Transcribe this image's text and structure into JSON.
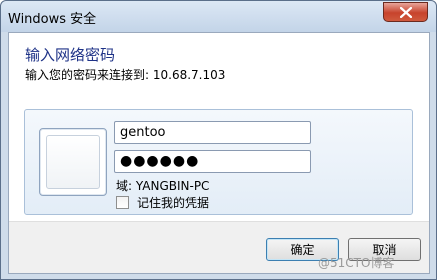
{
  "window": {
    "title": "Windows 安全",
    "close_icon": "close-icon"
  },
  "header": {
    "heading": "输入网络密码",
    "subheading": "输入您的密码来连接到: 10.68.7.103"
  },
  "credentials": {
    "username_value": "gentoo",
    "password_masked": "●●●●●●",
    "domain_text": "域: YANGBIN-PC",
    "remember_label": "记住我的凭据",
    "remember_checked": false,
    "user_tile_icon": "user-tile-icon"
  },
  "buttons": {
    "ok_label": "确定",
    "cancel_label": "取消"
  },
  "watermark": "@51CTO博客",
  "colors": {
    "heading": "#1e3287",
    "close_button": "#c7432c",
    "frame": "#cfdcea"
  }
}
